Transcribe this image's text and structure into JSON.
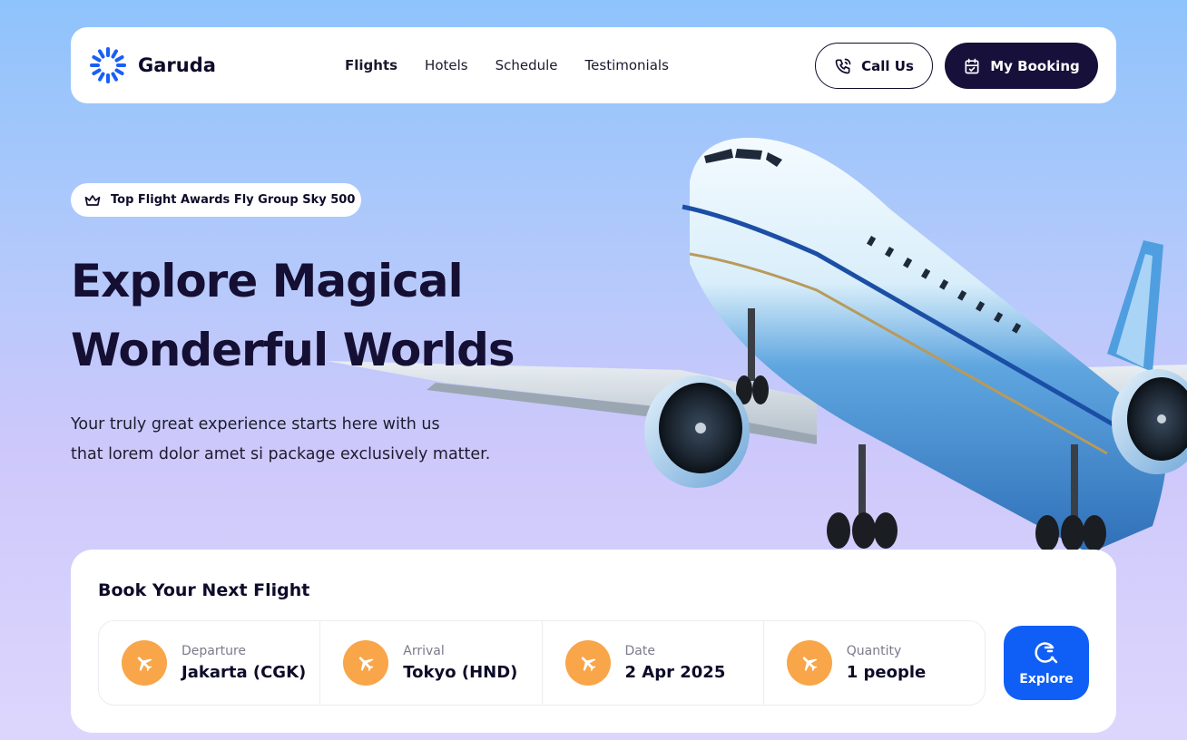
{
  "brand": {
    "name": "Garuda",
    "accent": "#1a5ff5"
  },
  "nav": {
    "links": [
      {
        "label": "Flights",
        "active": true
      },
      {
        "label": "Hotels"
      },
      {
        "label": "Schedule"
      },
      {
        "label": "Testimonials"
      }
    ],
    "call_label": "Call Us",
    "booking_label": "My Booking"
  },
  "hero": {
    "badge": "Top Flight Awards Fly Group Sky 500",
    "title_line1": "Explore Magical",
    "title_line2": "Wonderful Worlds",
    "subtitle_line1": "Your truly great experience starts here with us",
    "subtitle_line2": "that lorem dolor amet si package exclusively matter."
  },
  "booking": {
    "title": "Book Your Next Flight",
    "fields": [
      {
        "label": "Departure",
        "value": "Jakarta (CGK)",
        "icon": "airplane-icon"
      },
      {
        "label": "Arrival",
        "value": "Tokyo (HND)",
        "icon": "airplane-icon"
      },
      {
        "label": "Date",
        "value": "2 Apr 2025",
        "icon": "airplane-icon"
      },
      {
        "label": "Quantity",
        "value": "1 people",
        "icon": "airplane-icon"
      }
    ],
    "explore_label": "Explore"
  },
  "colors": {
    "icon_orange": "#f8a649",
    "explore_blue": "#0f5ff7",
    "dark_navy": "#16103a"
  }
}
